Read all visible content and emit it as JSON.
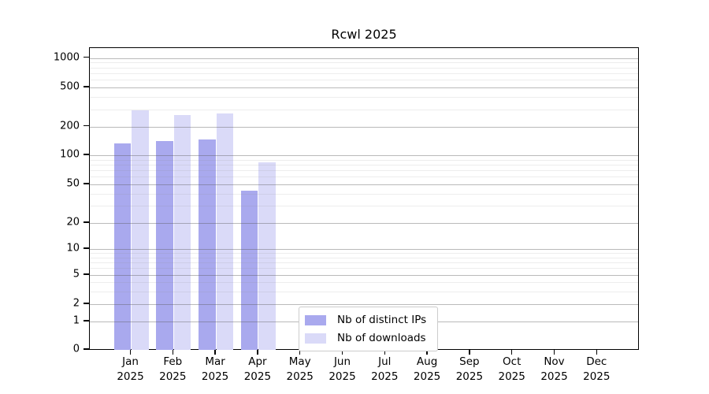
{
  "title": "Rcwl 2025",
  "legend": {
    "position": "inside-bottom-center",
    "items": [
      {
        "label": "Nb of distinct IPs",
        "color": "#a9a9ee"
      },
      {
        "label": "Nb of downloads",
        "color": "#dadaf8"
      }
    ]
  },
  "chart_data": {
    "type": "bar",
    "title": "Rcwl 2025",
    "categories": [
      "Jan 2025",
      "Feb 2025",
      "Mar 2025",
      "Apr 2025",
      "May 2025",
      "Jun 2025",
      "Jul 2025",
      "Aug 2025",
      "Sep 2025",
      "Oct 2025",
      "Nov 2025",
      "Dec 2025"
    ],
    "x_tick_months": [
      "Jan",
      "Feb",
      "Mar",
      "Apr",
      "May",
      "Jun",
      "Jul",
      "Aug",
      "Sep",
      "Oct",
      "Nov",
      "Dec"
    ],
    "x_tick_year": "2025",
    "series": [
      {
        "name": "Nb of distinct IPs",
        "color": "#a9a9ee",
        "values": [
          133,
          142,
          145,
          43,
          null,
          null,
          null,
          null,
          null,
          null,
          null,
          null
        ]
      },
      {
        "name": "Nb of downloads",
        "color": "#dadaf8",
        "values": [
          290,
          260,
          270,
          85,
          null,
          null,
          null,
          null,
          null,
          null,
          null,
          null
        ]
      }
    ],
    "xlabel": "",
    "ylabel": "",
    "y_axis": {
      "scale": "symlog",
      "ticks": [
        0,
        1,
        2,
        5,
        10,
        20,
        50,
        100,
        200,
        500,
        1000
      ],
      "minor_gridlines": [
        3,
        4,
        6,
        7,
        8,
        9,
        30,
        40,
        60,
        70,
        80,
        90,
        300,
        400,
        600,
        700,
        800,
        900
      ],
      "ylim": [
        0,
        1270
      ]
    },
    "grid": true,
    "legend_position": "lower center (inside plot)"
  }
}
